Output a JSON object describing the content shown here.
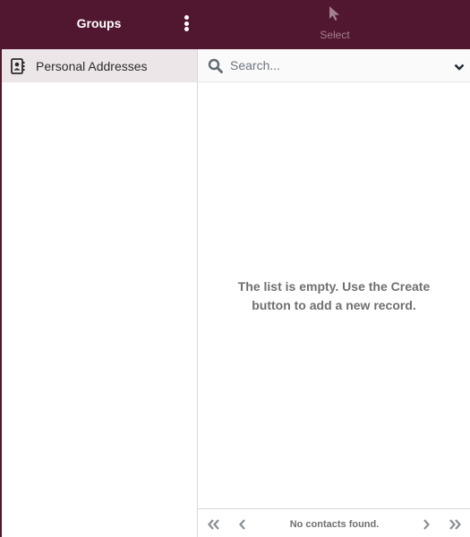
{
  "colors": {
    "brand": "#521730",
    "selected_bg": "#ede6e9",
    "muted_text": "#6f6f6f",
    "disabled_icon": "#a3808f"
  },
  "groups_panel": {
    "title": "Groups",
    "menu_icon": "kebab-vertical-icon",
    "items": [
      {
        "label": "Personal Addresses",
        "icon": "address-book-icon",
        "selected": true
      }
    ]
  },
  "toolbar": {
    "select_label": "Select",
    "select_icon": "cursor-pointer-icon"
  },
  "search": {
    "placeholder": "Search...",
    "value": "",
    "icon": "search-icon",
    "options_icon": "chevron-down-icon"
  },
  "list": {
    "empty_message": "The list is empty. Use the Create button to add a new record."
  },
  "pagination": {
    "status": "No contacts found.",
    "first_icon": "double-chevron-left-icon",
    "prev_icon": "chevron-left-icon",
    "next_icon": "chevron-right-icon",
    "last_icon": "double-chevron-right-icon"
  }
}
